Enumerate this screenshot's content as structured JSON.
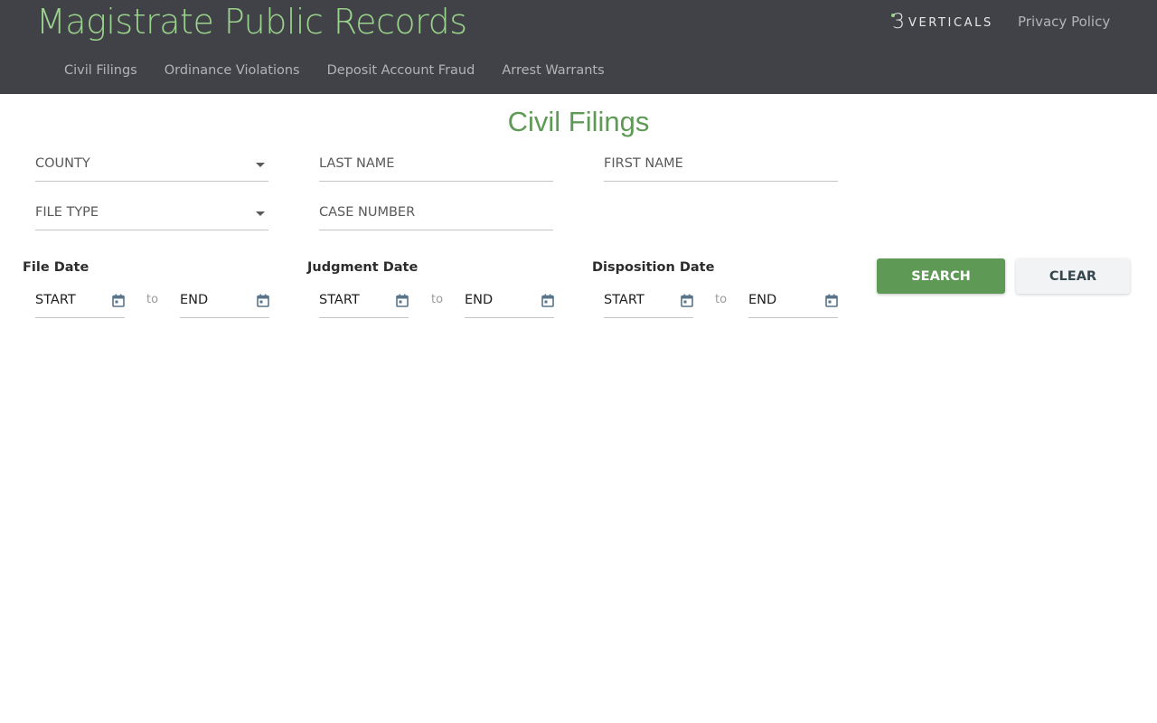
{
  "header": {
    "title": "Magistrate Public Records",
    "brand": {
      "number": "3",
      "text": "VERTICALS"
    },
    "privacy_link": "Privacy Policy",
    "nav": [
      "Civil Filings",
      "Ordinance Violations",
      "Deposit Account Fraud",
      "Arrest Warrants"
    ]
  },
  "page_title": "Civil Filings",
  "form": {
    "county_placeholder": "COUNTY",
    "last_name_placeholder": "LAST NAME",
    "first_name_placeholder": "FIRST NAME",
    "file_type_placeholder": "FILE TYPE",
    "case_number_placeholder": "CASE NUMBER"
  },
  "date_ranges": [
    {
      "label": "File Date",
      "start": "START",
      "to": "to",
      "end": "END"
    },
    {
      "label": "Judgment Date",
      "start": "START",
      "to": "to",
      "end": "END"
    },
    {
      "label": "Disposition Date",
      "start": "START",
      "to": "to",
      "end": "END"
    }
  ],
  "buttons": {
    "search": "SEARCH",
    "clear": "CLEAR"
  },
  "colors": {
    "header_bg": "#414247",
    "title_green": "#9ad38c",
    "accent_green": "#5e9a56",
    "clear_bg": "#f1f3f4"
  },
  "icons": {
    "dropdown": "caret-down-icon",
    "date": "calendar-icon",
    "brand": "brand-logo-icon"
  }
}
